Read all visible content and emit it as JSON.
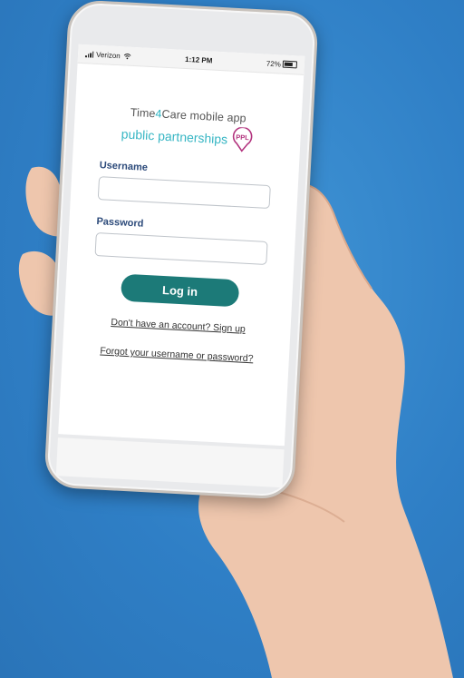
{
  "status_bar": {
    "carrier": "Verizon",
    "time": "1:12 PM",
    "battery_percent": "72%",
    "battery_level": 0.72,
    "signal_icon": "signal-bars-icon",
    "wifi_icon": "wifi-icon"
  },
  "brand": {
    "app_prefix": "Time",
    "app_accent": "4",
    "app_suffix": "Care mobile app",
    "company": "public partnerships",
    "logo_text": "PPL",
    "colors": {
      "teal": "#37b6c4",
      "magenta": "#b2337e"
    }
  },
  "login_form": {
    "username_label": "Username",
    "username_value": "",
    "password_label": "Password",
    "password_value": "",
    "login_button": "Log in",
    "button_color": "#1c7a78"
  },
  "links": {
    "signup": "Don't have an account? Sign up",
    "forgot": "Forgot your username or password?"
  }
}
